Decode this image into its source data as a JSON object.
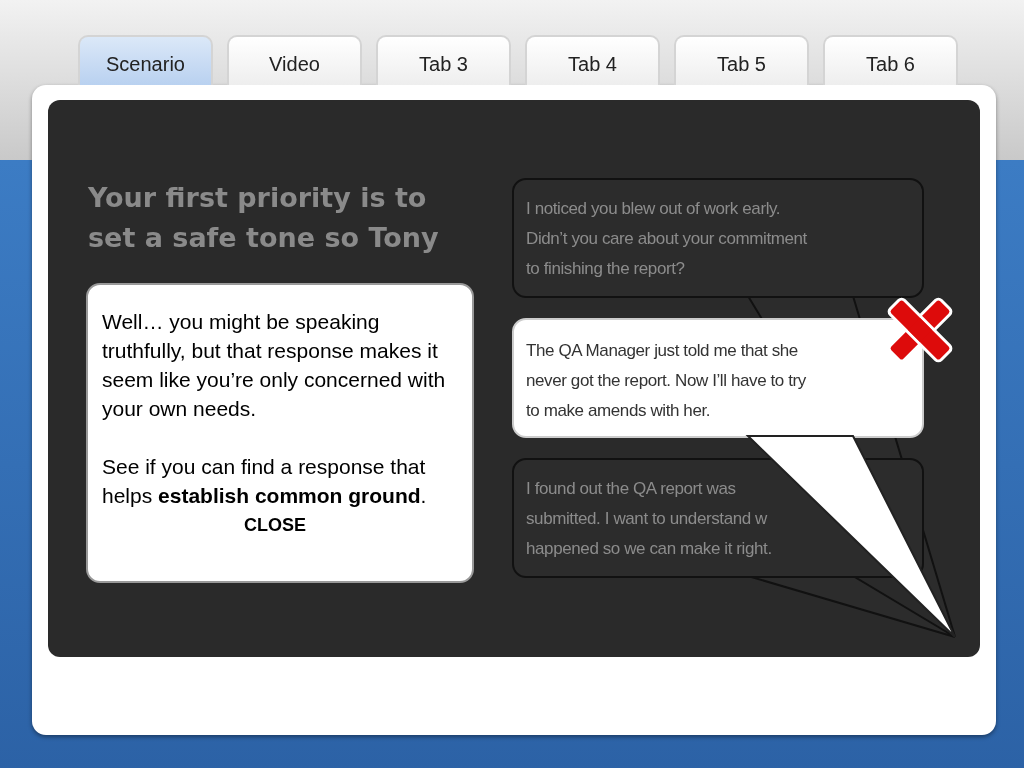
{
  "tabs": [
    {
      "label": "Scenario",
      "selected": true
    },
    {
      "label": "Video",
      "selected": false
    },
    {
      "label": "Tab 3",
      "selected": false
    },
    {
      "label": "Tab 4",
      "selected": false
    },
    {
      "label": "Tab 5",
      "selected": false
    },
    {
      "label": "Tab 6",
      "selected": false
    }
  ],
  "heading": [
    "Your first priority is to",
    "set a safe tone so Tony"
  ],
  "responses": [
    {
      "lines": [
        "I noticed you blew out of work early.",
        "Didn’t you care about your commitment",
        "to finishing the report?"
      ],
      "selected": false,
      "incorrect": false
    },
    {
      "lines": [
        "The QA Manager just told me that she",
        "never got the report. Now I’ll have to try",
        "to make amends with her."
      ],
      "selected": true,
      "incorrect": true
    },
    {
      "lines": [
        "I found out the QA report was",
        "submitted. I want to understand w",
        "happened so we can make it right."
      ],
      "selected": false,
      "incorrect": false
    }
  ],
  "feedback": {
    "paragraphs": [
      "Well… you might be speaking truthfully, but that response makes it seem like you’re only concerned with your own needs.",
      "See if you can find a response that helps **establish common ground**."
    ],
    "close": "CLOSE"
  }
}
